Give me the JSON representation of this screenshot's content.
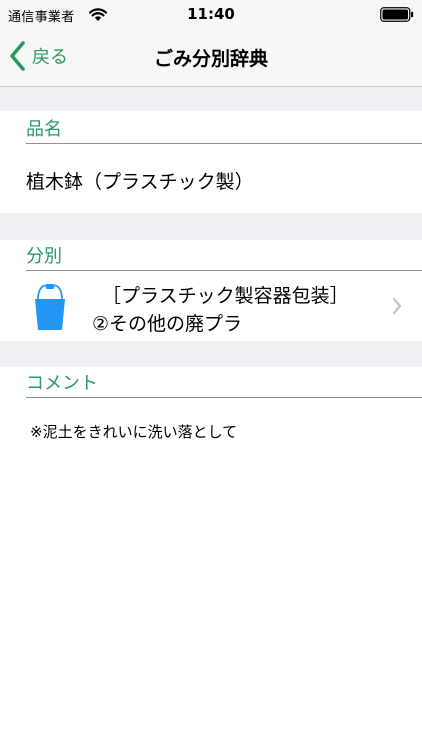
{
  "status_bar": {
    "carrier": "通信事業者",
    "time": "11:40"
  },
  "nav": {
    "back_label": "戻る",
    "title": "ごみ分別辞典"
  },
  "item": {
    "header": "品名",
    "name": "植木鉢（プラスチック製）"
  },
  "category": {
    "header": "分別",
    "line1": "［プラスチック製容器包装］",
    "line2": "②その他の廃プラ",
    "icon": "bucket-icon",
    "icon_color": "#2196f3"
  },
  "comment": {
    "header": "コメント",
    "text": "※泥土をきれいに洗い落として"
  },
  "colors": {
    "accent": "#2a9a62",
    "section_gap": "#efeff4"
  }
}
